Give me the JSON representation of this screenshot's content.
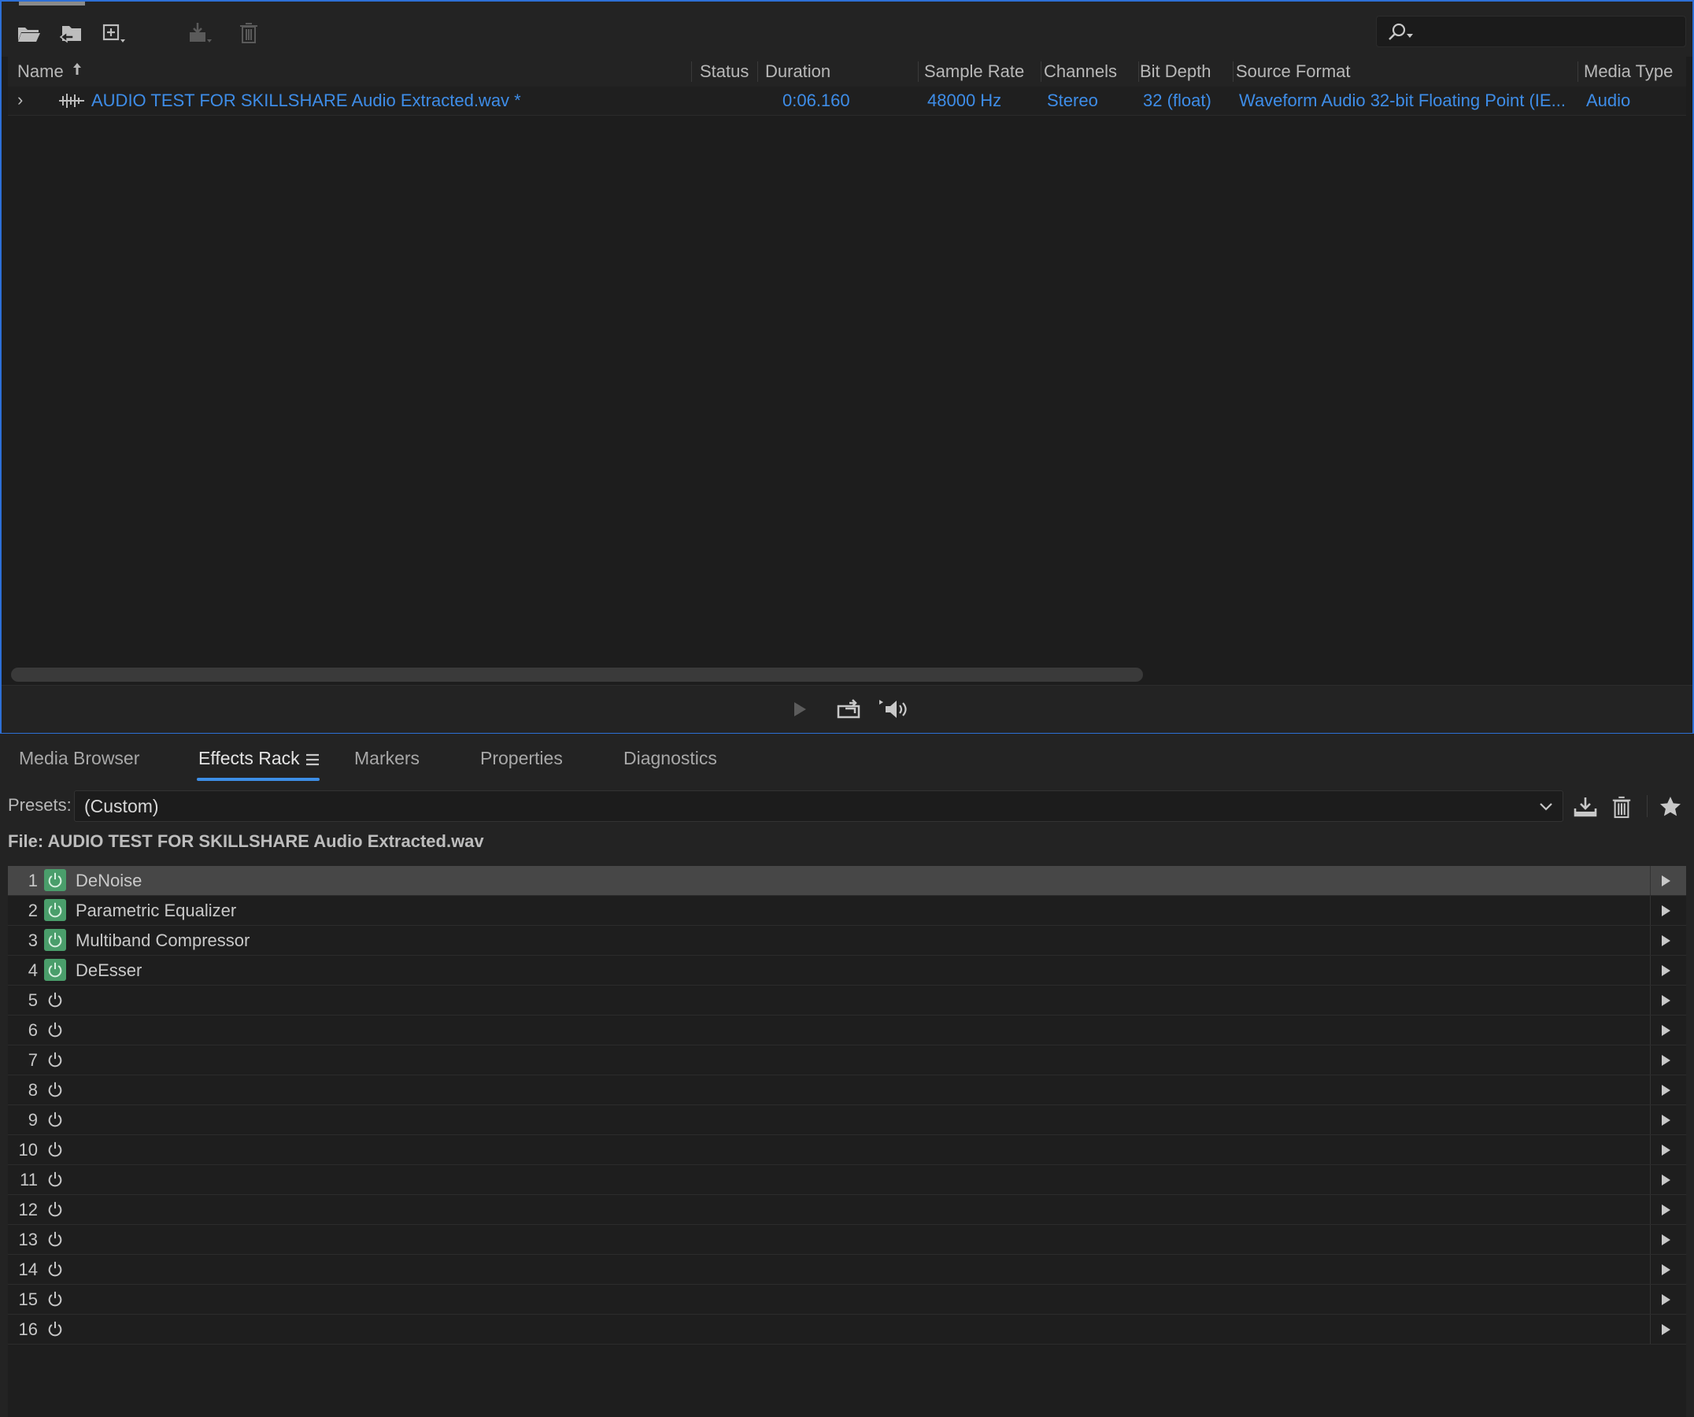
{
  "files_panel": {
    "search": {
      "placeholder": ""
    },
    "columns": {
      "name": "Name",
      "status": "Status",
      "duration": "Duration",
      "sample_rate": "Sample Rate",
      "channels": "Channels",
      "bit_depth": "Bit Depth",
      "source_format": "Source Format",
      "media_type": "Media Type"
    },
    "file": {
      "name": "AUDIO TEST FOR SKILLSHARE Audio Extracted.wav *",
      "status": "",
      "duration": "0:06.160",
      "sample_rate": "48000 Hz",
      "channels": "Stereo",
      "bit_depth": "32 (float)",
      "source_format": "Waveform Audio 32-bit Floating Point (IE...",
      "media_type": "Audio"
    }
  },
  "tabs": {
    "media_browser": "Media Browser",
    "effects_rack": "Effects Rack",
    "markers": "Markers",
    "properties": "Properties",
    "diagnostics": "Diagnostics"
  },
  "effects_rack": {
    "presets_label": "Presets:",
    "presets_value": "(Custom)",
    "file_label": "File: AUDIO TEST FOR SKILLSHARE Audio Extracted.wav",
    "slots": [
      {
        "num": "1",
        "name": "DeNoise",
        "on": true,
        "selected": true
      },
      {
        "num": "2",
        "name": "Parametric Equalizer",
        "on": true,
        "selected": false
      },
      {
        "num": "3",
        "name": "Multiband Compressor",
        "on": true,
        "selected": false
      },
      {
        "num": "4",
        "name": "DeEsser",
        "on": true,
        "selected": false
      },
      {
        "num": "5",
        "name": "",
        "on": false,
        "selected": false
      },
      {
        "num": "6",
        "name": "",
        "on": false,
        "selected": false
      },
      {
        "num": "7",
        "name": "",
        "on": false,
        "selected": false
      },
      {
        "num": "8",
        "name": "",
        "on": false,
        "selected": false
      },
      {
        "num": "9",
        "name": "",
        "on": false,
        "selected": false
      },
      {
        "num": "10",
        "name": "",
        "on": false,
        "selected": false
      },
      {
        "num": "11",
        "name": "",
        "on": false,
        "selected": false
      },
      {
        "num": "12",
        "name": "",
        "on": false,
        "selected": false
      },
      {
        "num": "13",
        "name": "",
        "on": false,
        "selected": false
      },
      {
        "num": "14",
        "name": "",
        "on": false,
        "selected": false
      },
      {
        "num": "15",
        "name": "",
        "on": false,
        "selected": false
      },
      {
        "num": "16",
        "name": "",
        "on": false,
        "selected": false
      }
    ]
  },
  "colors": {
    "accent_blue": "#3e8de8",
    "power_on_green": "#4a9e6b",
    "panel_border": "#2d6fd6"
  }
}
